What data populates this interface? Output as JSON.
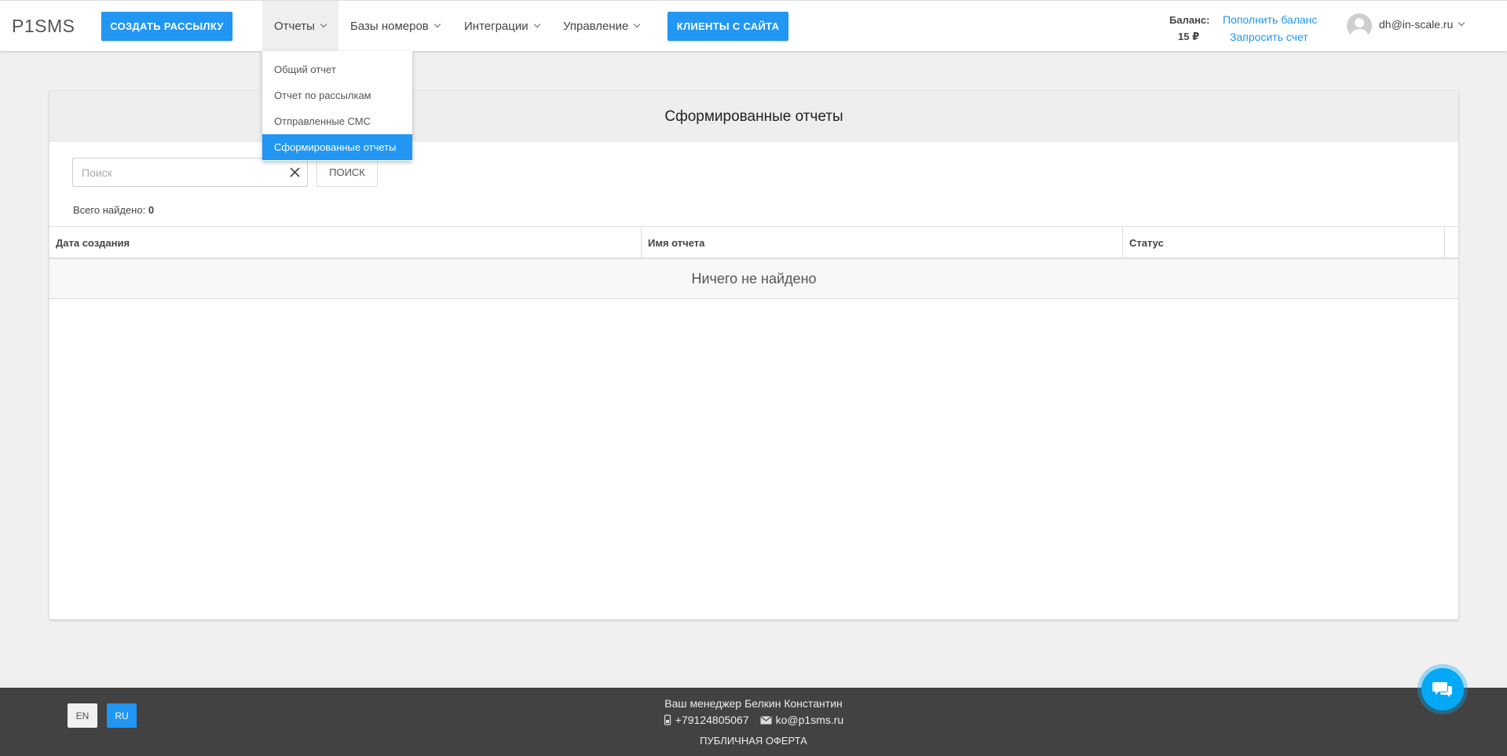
{
  "header": {
    "logo": "P1SMS",
    "create_button": "СОЗДАТЬ РАССЫЛКУ",
    "nav": {
      "reports": "Отчеты",
      "bases": "Базы номеров",
      "integrations": "Интеграции",
      "management": "Управление"
    },
    "clients_button": "КЛИЕНТЫ С САЙТА",
    "balance_label": "Баланс:",
    "balance_value": "15 ₽",
    "topup_link": "Пополнить баланс",
    "invoice_link": "Запросить счет",
    "user_email": "dh@in-scale.ru"
  },
  "dropdown": {
    "items": [
      "Общий отчет",
      "Отчет по рассылкам",
      "Отправленные СМС",
      "Сформированные отчеты"
    ],
    "selected_index": 3
  },
  "main": {
    "title": "Сформированные отчеты",
    "search": {
      "placeholder": "Поиск",
      "value": "",
      "button": "поиск"
    },
    "found_label": "Всего найдено:",
    "found_count": "0",
    "table": {
      "columns": [
        "Дата создания",
        "Имя отчета",
        "Статус"
      ],
      "rows": [],
      "empty_text": "Ничего не найдено"
    }
  },
  "footer": {
    "languages": [
      "EN",
      "RU"
    ],
    "active_language": "RU",
    "manager": "Ваш менеджер Белкин Константин",
    "phone": "+79124805067",
    "email": "ko@p1sms.ru",
    "offer": "ПУБЛИЧНАЯ ОФЕРТА"
  },
  "colors": {
    "accent": "#2196f3",
    "footer_bg": "#424242",
    "chat": "#03a9f4"
  },
  "icons": [
    "chevron-down-icon",
    "close-icon",
    "user-avatar-icon",
    "phone-icon",
    "mail-icon",
    "chat-icon"
  ]
}
